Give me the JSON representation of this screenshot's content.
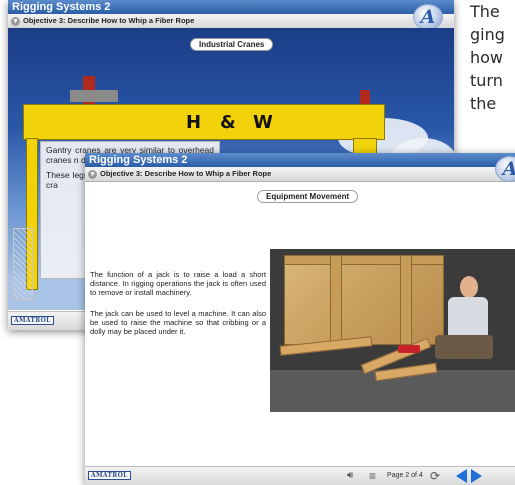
{
  "side_text": [
    "The",
    "ging",
    "how",
    "turn",
    "the"
  ],
  "back_window": {
    "title": "Rigging Systems 2",
    "objective": "Objective 3: Describe How to Whip a Fiber Rope",
    "section": "Industrial Cranes",
    "crane_letters": [
      "H",
      "&",
      "W"
    ],
    "para1": "Gantry cranes are very similar to overhead cranes n difference is bridge girde legs.",
    "para2": "These legs cranes are there is no overhead cra",
    "brand": "AMATROL"
  },
  "front_window": {
    "title": "Rigging Systems 2",
    "objective": "Objective 3: Describe How to Whip a Fiber Rope",
    "section": "Equipment Movement",
    "para1": "The function of a jack is to raise a load a short distance. In rigging operations the jack is often used to remove or install machinery.",
    "para2": "The jack can be used to level a machine. It can also be used to raise the machine so that cribbing or a dolly may be placed under it.",
    "brand": "AMATROL",
    "page_indicator": "Page 2 of 4"
  },
  "logo_letter": "A",
  "colors": {
    "title_bar": "#2b5da8",
    "crane_yellow": "#f2d20b",
    "nav_blue": "#1f6fd6"
  },
  "icons": [
    "chevron-down-icon",
    "speaker-icon",
    "menu-icon",
    "refresh-icon",
    "prev-arrow-icon",
    "next-arrow-icon"
  ]
}
